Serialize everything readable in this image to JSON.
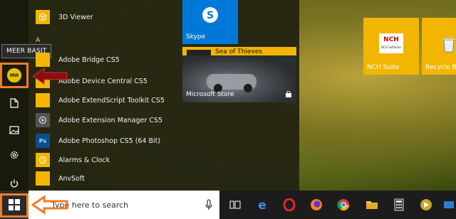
{
  "tooltip": {
    "text": "MEER BASIT"
  },
  "user": {
    "initials": "MW"
  },
  "app_list": {
    "items": [
      {
        "label": "3D Viewer",
        "color": "#f2b600"
      },
      {
        "label": "Adobe Bridge CS5",
        "color": "#f2b600"
      },
      {
        "label": "Adobe Device Central CS5",
        "color": "#f2b600"
      },
      {
        "label": "Adobe ExtendScript Toolkit CS5",
        "color": "#f2b600"
      },
      {
        "label": "Adobe Extension Manager CS5",
        "color": "#555555"
      },
      {
        "label": "Adobe Photoshop CS5 (64 Bit)",
        "color": "#0b4f8a"
      },
      {
        "label": "Alarms & Clock",
        "color": "#f2b600"
      },
      {
        "label": "AnvSoft",
        "color": "#f2b600"
      }
    ],
    "section_letter": "A",
    "ps_icon_text": "Ps"
  },
  "tiles": {
    "skype": {
      "label": "Skype",
      "color": "#0078d7"
    },
    "sea_of_thieves": {
      "label": "Sea of Thieves",
      "color": "#f2b600"
    },
    "store": {
      "label": "Microsoft Store"
    },
    "nch": {
      "label": "NCH Suite",
      "logo": "NCH",
      "sub": "NCH Software",
      "color": "#f2b600"
    },
    "recycle": {
      "label": "Recycle Bin",
      "color": "#f2b600"
    }
  },
  "taskbar": {
    "search_placeholder": "Type here to search"
  },
  "colors": {
    "accent": "#f07d2a",
    "arrow_red": "#8b0f12"
  }
}
